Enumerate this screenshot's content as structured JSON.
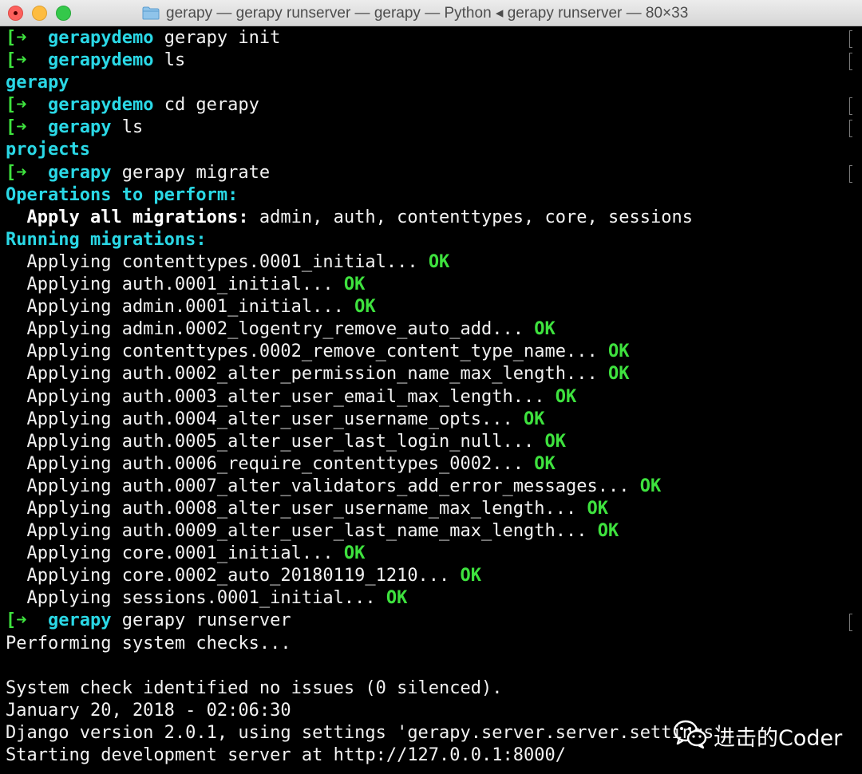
{
  "window": {
    "title": "gerapy — gerapy runserver — gerapy — Python ◂ gerapy runserver — 80×33",
    "title_icon": "folder-icon"
  },
  "prompt": {
    "marker": "[",
    "arrow": "➜"
  },
  "terminal": {
    "lines": [
      {
        "type": "prompt",
        "cwd": "gerapydemo",
        "cmd": " gerapy init"
      },
      {
        "type": "prompt",
        "cwd": "gerapydemo",
        "cmd": " ls"
      },
      {
        "type": "cyan",
        "text": "gerapy"
      },
      {
        "type": "prompt",
        "cwd": "gerapydemo",
        "cmd": " cd gerapy"
      },
      {
        "type": "prompt",
        "cwd": "gerapy",
        "cmd": " ls"
      },
      {
        "type": "cyan",
        "text": "projects"
      },
      {
        "type": "prompt",
        "cwd": "gerapy",
        "cmd": " gerapy migrate"
      },
      {
        "type": "cyan",
        "text": "Operations to perform:"
      },
      {
        "type": "apply",
        "label": "  Apply all migrations:",
        "text": " admin, auth, contenttypes, core, sessions"
      },
      {
        "type": "cyan",
        "text": "Running migrations:"
      },
      {
        "type": "ok",
        "text": "  Applying contenttypes.0001_initial... ",
        "status": "OK"
      },
      {
        "type": "ok",
        "text": "  Applying auth.0001_initial... ",
        "status": "OK"
      },
      {
        "type": "ok",
        "text": "  Applying admin.0001_initial... ",
        "status": "OK"
      },
      {
        "type": "ok",
        "text": "  Applying admin.0002_logentry_remove_auto_add... ",
        "status": "OK"
      },
      {
        "type": "ok",
        "text": "  Applying contenttypes.0002_remove_content_type_name... ",
        "status": "OK"
      },
      {
        "type": "ok",
        "text": "  Applying auth.0002_alter_permission_name_max_length... ",
        "status": "OK"
      },
      {
        "type": "ok",
        "text": "  Applying auth.0003_alter_user_email_max_length... ",
        "status": "OK"
      },
      {
        "type": "ok",
        "text": "  Applying auth.0004_alter_user_username_opts... ",
        "status": "OK"
      },
      {
        "type": "ok",
        "text": "  Applying auth.0005_alter_user_last_login_null... ",
        "status": "OK"
      },
      {
        "type": "ok",
        "text": "  Applying auth.0006_require_contenttypes_0002... ",
        "status": "OK"
      },
      {
        "type": "ok",
        "text": "  Applying auth.0007_alter_validators_add_error_messages... ",
        "status": "OK"
      },
      {
        "type": "ok",
        "text": "  Applying auth.0008_alter_user_username_max_length... ",
        "status": "OK"
      },
      {
        "type": "ok",
        "text": "  Applying auth.0009_alter_user_last_name_max_length... ",
        "status": "OK"
      },
      {
        "type": "ok",
        "text": "  Applying core.0001_initial... ",
        "status": "OK"
      },
      {
        "type": "ok",
        "text": "  Applying core.0002_auto_20180119_1210... ",
        "status": "OK"
      },
      {
        "type": "ok",
        "text": "  Applying sessions.0001_initial... ",
        "status": "OK"
      },
      {
        "type": "prompt",
        "cwd": "gerapy",
        "cmd": " gerapy runserver"
      },
      {
        "type": "plain",
        "text": "Performing system checks..."
      },
      {
        "type": "plain",
        "text": ""
      },
      {
        "type": "plain",
        "text": "System check identified no issues (0 silenced)."
      },
      {
        "type": "plain",
        "text": "January 20, 2018 - 02:06:30"
      },
      {
        "type": "plain",
        "text": "Django version 2.0.1, using settings 'gerapy.server.server.settings'"
      },
      {
        "type": "plain",
        "text": "Starting development server at http://127.0.0.1:8000/"
      }
    ]
  },
  "watermark": {
    "icon": "wechat-icon",
    "text": "进击的Coder"
  },
  "colors": {
    "background": "#000000",
    "prompt_arrow": "#3ee23e",
    "cwd": "#2ad8e6",
    "ok": "#3ee23e",
    "text": "#f2f2f2"
  }
}
